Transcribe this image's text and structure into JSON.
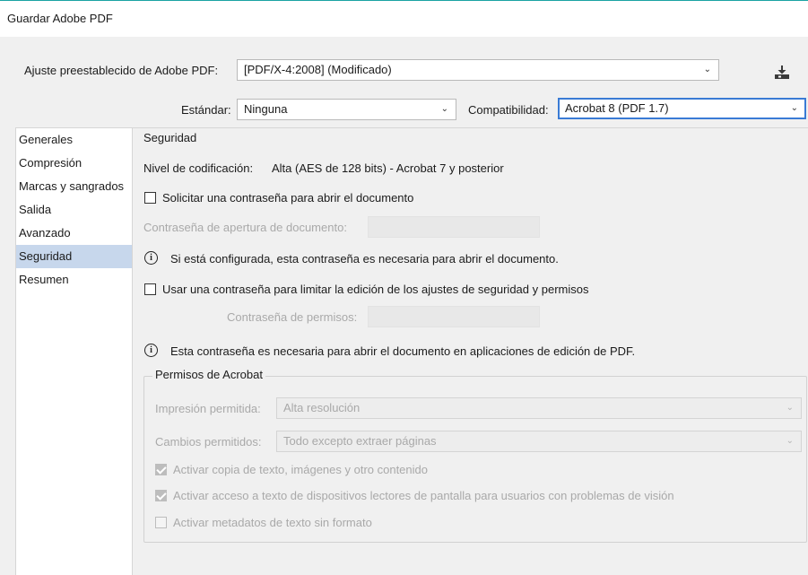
{
  "window": {
    "title": "Guardar Adobe PDF"
  },
  "preset": {
    "label": "Ajuste preestablecido de Adobe PDF:",
    "value": "[PDF/X-4:2008] (Modificado)"
  },
  "standard": {
    "label": "Estándar:",
    "value": "Ninguna"
  },
  "compatibility": {
    "label": "Compatibilidad:",
    "value": "Acrobat 8 (PDF 1.7)"
  },
  "sidebar": {
    "items": [
      {
        "label": "Generales",
        "active": false
      },
      {
        "label": "Compresión",
        "active": false
      },
      {
        "label": "Marcas y sangrados",
        "active": false
      },
      {
        "label": "Salida",
        "active": false
      },
      {
        "label": "Avanzado",
        "active": false
      },
      {
        "label": "Seguridad",
        "active": true
      },
      {
        "label": "Resumen",
        "active": false
      }
    ]
  },
  "security": {
    "title": "Seguridad",
    "encryption_label": "Nivel de codificación:",
    "encryption_value": "Alta (AES de 128 bits) - Acrobat 7 y posterior",
    "require_open_password": {
      "label": "Solicitar una contraseña para abrir el documento",
      "checked": false
    },
    "open_password_label": "Contraseña de apertura de documento:",
    "open_password_info": "Si está configurada, esta contraseña es necesaria para abrir el documento.",
    "use_permissions_password": {
      "label": "Usar una contraseña para limitar la edición de los ajustes de seguridad y permisos",
      "checked": false
    },
    "permissions_password_label": "Contraseña de permisos:",
    "permissions_info": "Esta contraseña es necesaria para abrir el documento en aplicaciones de edición de PDF."
  },
  "permissions": {
    "legend": "Permisos de Acrobat",
    "printing_label": "Impresión permitida:",
    "printing_value": "Alta resolución",
    "changes_label": "Cambios permitidos:",
    "changes_value": "Todo excepto extraer páginas",
    "options": [
      {
        "label": "Activar copia de texto, imágenes y otro contenido",
        "checked": true
      },
      {
        "label": "Activar acceso a texto de dispositivos lectores de pantalla para usuarios con problemas de visión",
        "checked": true
      },
      {
        "label": "Activar metadatos de texto sin formato",
        "checked": false
      }
    ]
  },
  "icons": {
    "dropdown": "chevron-down-icon",
    "save_preset": "save-preset-icon",
    "info": "info-icon"
  }
}
